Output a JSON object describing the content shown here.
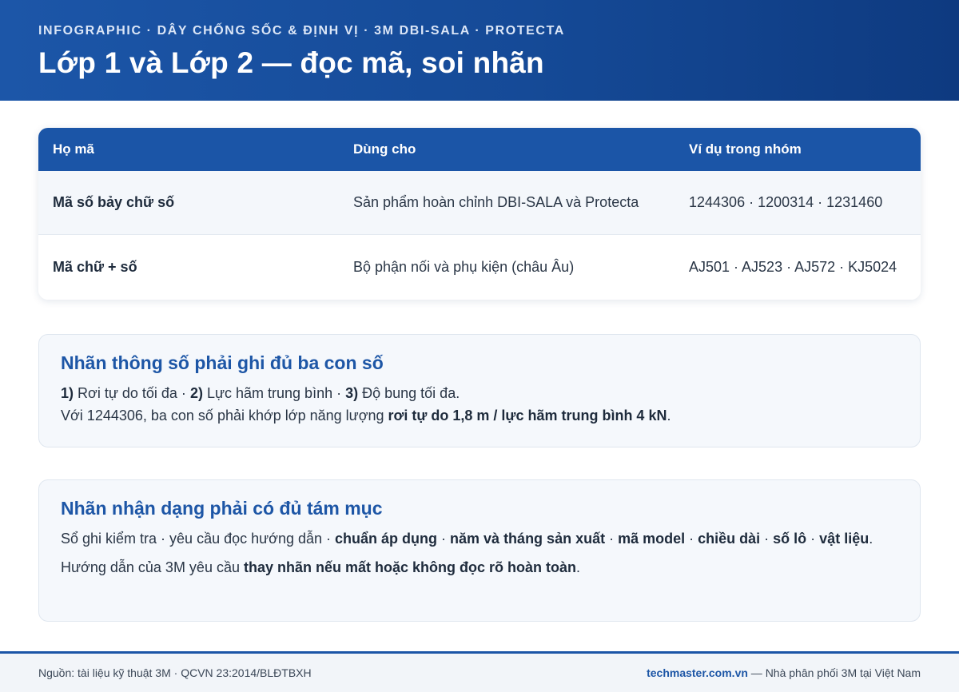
{
  "header": {
    "kicker": "INFOGRAPHIC · DÂY CHỐNG SỐC & ĐỊNH VỊ · 3M DBI-SALA · PROTECTA",
    "title": "Lớp 1 và Lớp 2 — đọc mã, soi nhãn"
  },
  "table": {
    "columns": [
      "Họ mã",
      "Dùng cho",
      "Ví dụ trong nhóm"
    ],
    "rows": [
      {
        "family": "Mã số bảy chữ số",
        "use": "Sản phẩm hoàn chỉnh DBI-SALA và Protecta",
        "examples": "1244306 · 1200314 · 1231460"
      },
      {
        "family": "Mã chữ + số",
        "use": "Bộ phận nối và phụ kiện (châu Âu)",
        "examples": "AJ501 · AJ523 · AJ572 · KJ5024"
      }
    ]
  },
  "panel_spec": {
    "heading": "Nhãn thông số phải ghi đủ ba con số",
    "line1": {
      "n1": "1)",
      "t1": " Rơi tự do tối đa · ",
      "n2": "2)",
      "t2": " Lực hãm trung bình · ",
      "n3": "3)",
      "t3": " Độ bung tối đa."
    },
    "line2": {
      "pre": "Với 1244306, ba con số phải khớp lớp năng lượng ",
      "bold": "rơi tự do 1,8 m / lực hãm trung bình 4 kN",
      "post": "."
    }
  },
  "panel_id": {
    "heading": "Nhãn nhận dạng phải có đủ tám mục",
    "line1": {
      "t1": "Sổ ghi kiểm tra · yêu cầu đọc hướng dẫn · ",
      "b1": "chuẩn áp dụng",
      "s1": " · ",
      "b2": "năm và tháng sản xuất",
      "s2": " · ",
      "b3": "mã model",
      "s3": " · ",
      "b4": "chiều dài",
      "s4": " · ",
      "b5": "số lô",
      "s5": " · ",
      "b6": "vật liệu",
      "end": "."
    },
    "line2": {
      "pre": "Hướng dẫn của 3M yêu cầu ",
      "bold": "thay nhãn nếu mất hoặc không đọc rõ hoàn toàn",
      "post": "."
    }
  },
  "footer": {
    "source": "Nguồn: tài liệu kỹ thuật 3M · QCVN 23:2014/BLĐTBXH",
    "site": "techmaster.com.vn",
    "tagline": " — Nhà phân phối 3M tại Việt Nam"
  }
}
